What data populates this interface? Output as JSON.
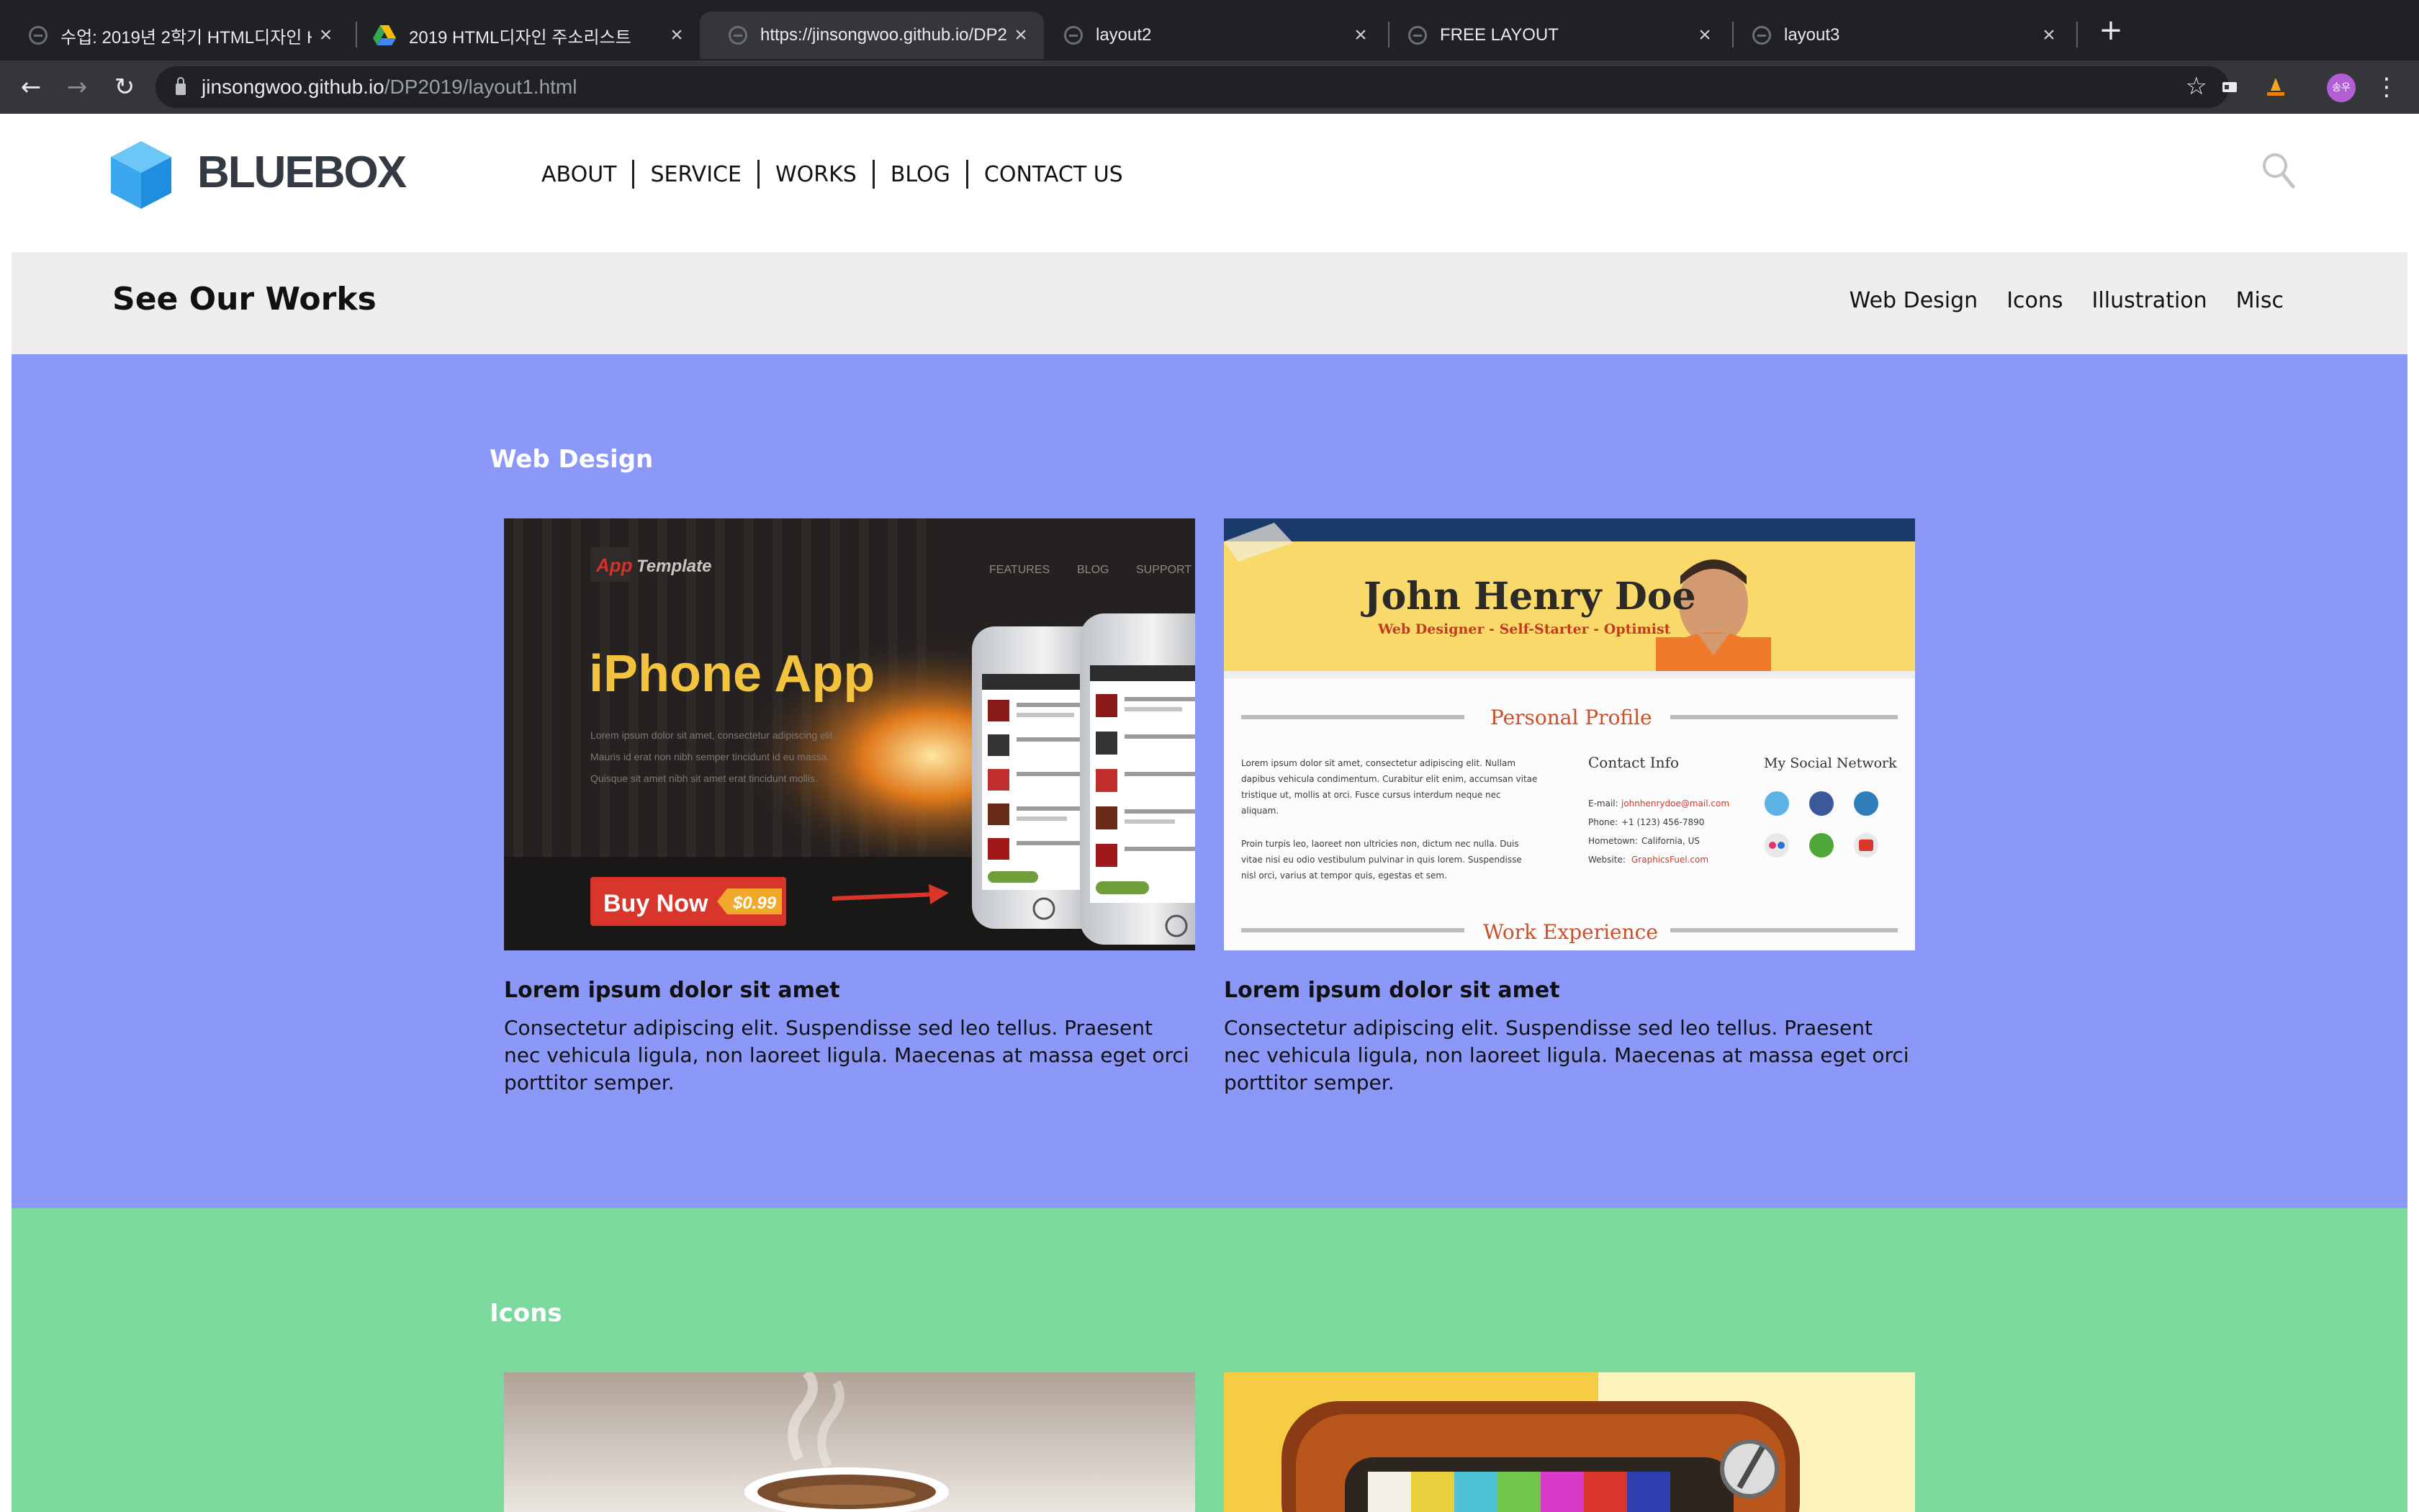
{
  "browser": {
    "tabs": [
      {
        "title": "수업: 2019년 2학기 HTML디자인 H",
        "active": false
      },
      {
        "title": "2019 HTML디자인 주소리스트",
        "active": false
      },
      {
        "title": "https://jinsongwoo.github.io/DP2",
        "active": true
      },
      {
        "title": "layout2",
        "active": false
      },
      {
        "title": "FREE LAYOUT",
        "active": false
      },
      {
        "title": "layout3",
        "active": false
      }
    ],
    "close_glyph": "×",
    "new_tab_glyph": "+",
    "url_host": "jinsongwoo.github.io",
    "url_path": "/DP2019/layout1.html",
    "back_glyph": "←",
    "forward_glyph": "→",
    "reload_glyph": "↻",
    "bookmark_glyph": "☆",
    "profile_initials": "송우",
    "menu_glyph": "⋮"
  },
  "site": {
    "brand": "BLUEBOX",
    "nav": [
      "ABOUT",
      "SERVICE",
      "WORKS",
      "BLOG",
      "CONTACT US"
    ],
    "subheader_title": "See Our Works",
    "subnav": [
      "Web Design",
      "Icons",
      "Illustration",
      "Misc"
    ]
  },
  "sections": {
    "web": {
      "title": "Web Design",
      "color": "#8b98f8",
      "cards": [
        {
          "title": "Lorem ipsum dolor sit amet",
          "text": "Consectetur adipiscing elit. Suspendisse sed leo tellus. Praesent nec vehicula ligula, non laoreet ligula. Maecenas at massa eget orci porttitor semper."
        },
        {
          "title": "Lorem ipsum dolor sit amet",
          "text": "Consectetur adipiscing elit. Suspendisse sed leo tellus. Praesent nec vehicula ligula, non laoreet ligula. Maecenas at massa eget orci porttitor semper."
        }
      ]
    },
    "icons": {
      "title": "Icons",
      "color": "#7cd99d"
    }
  },
  "thumb_app": {
    "brand_app": "App",
    "brand_template": "Template",
    "nav": [
      "FEATURES",
      "BLOG",
      "SUPPORT"
    ],
    "headline": "iPhone App",
    "lorem": [
      "Lorem ipsum dolor sit amet, consectetur adipiscing elit.",
      "Mauris id erat non nibh semper tincidunt id eu massa.",
      "Quisque sit amet nibh sit amet erat tincidunt mollis."
    ],
    "buy": "Buy Now",
    "price": "$0.99"
  },
  "thumb_resume": {
    "name": "John Henry Doe",
    "tagline": "Web Designer - Self-Starter - Optimist",
    "profile_heading": "Personal Profile",
    "para1": [
      "Lorem ipsum dolor sit amet, consectetur adipiscing elit. Nullam",
      "dapibus vehicula condimentum. Curabitur elit enim, accumsan vitae",
      "tristique ut, mollis at orci. Fusce cursus interdum neque nec",
      "aliquam."
    ],
    "para2": [
      "Proin turpis leo, laoreet non ultricies non, dictum nec nulla. Duis",
      "vitae nisi eu odio vestibulum pulvinar in quis lorem. Suspendisse",
      "nisl orci, varius at tempor quis, egestas et sem."
    ],
    "contact_heading": "Contact Info",
    "contact": [
      {
        "label": "E-mail:",
        "value": "johnhenrydoe@mail.com"
      },
      {
        "label": "Phone:",
        "value": "+1 (123) 456-7890"
      },
      {
        "label": "Hometown:",
        "value": "California, US"
      },
      {
        "label": "Website:",
        "value": "GraphicsFuel.com"
      }
    ],
    "social_heading": "My Social Network",
    "work_heading": "Work Experience"
  }
}
